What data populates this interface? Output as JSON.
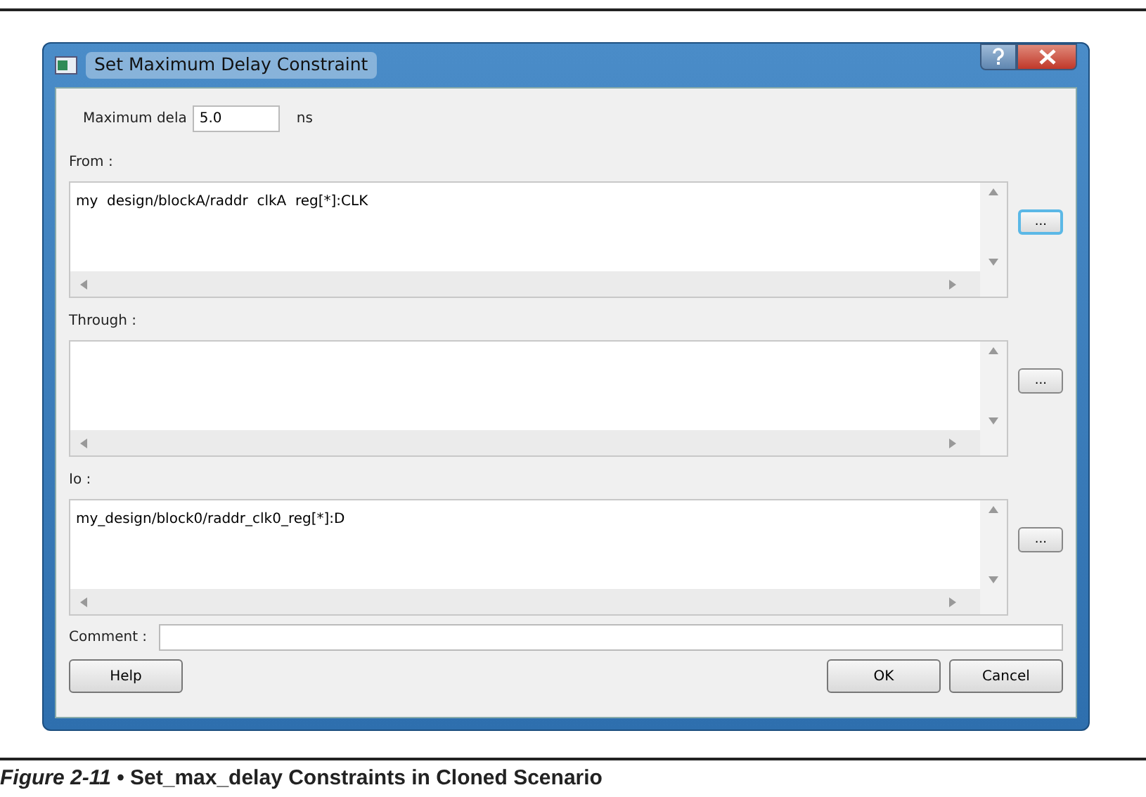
{
  "window": {
    "title": "Set Maximum Delay Constraint"
  },
  "max_delay": {
    "label": "Maximum dela",
    "value": "5.0",
    "unit": "ns"
  },
  "lists": [
    {
      "label": "From :",
      "value": "my  design/blockA/raddr  clkA  reg[*]:CLK",
      "button": "...",
      "focused": true
    },
    {
      "label": "Through :",
      "button": "...",
      "focused": false
    },
    {
      "label": "Io :",
      "value": "my_design/block0/raddr_clk0_reg[*]:D",
      "button": "...",
      "focused": false
    }
  ],
  "comment": {
    "label": "Comment :"
  },
  "buttons": {
    "help": "Help",
    "ok": "OK",
    "cancel": "Cancel"
  },
  "caption": "*Figure 2-11* • Set_max_delay Constraints in Cloned Scenario"
}
